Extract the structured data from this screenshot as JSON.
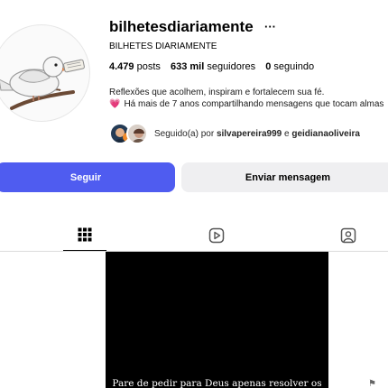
{
  "profile": {
    "username": "bilhetesdiariamente",
    "more_icon": "more-icon",
    "full_name": "BILHETES DIARIAMENTE",
    "stats": {
      "posts_count": "4.479",
      "posts_label": "posts",
      "followers_count": "633 mil",
      "followers_label": "seguidores",
      "following_count": "0",
      "following_label": "seguindo"
    },
    "bio": {
      "line1": "Reflexões que acolhem, inspiram e fortalecem sua fé.",
      "line2_emoji": "💗",
      "line2": "Há mais de 7 anos compartilhando mensagens que tocam almas"
    },
    "followed_by": {
      "prefix": "Seguido(a) por",
      "user1": "silvapereira999",
      "conjunction": "e",
      "user2": "geidianaoliveira"
    }
  },
  "actions": {
    "follow_label": "Seguir",
    "message_label": "Enviar mensagem"
  },
  "tabs": [
    {
      "icon": "grid-icon",
      "active": true
    },
    {
      "icon": "reels-icon",
      "active": false
    },
    {
      "icon": "tagged-icon",
      "active": false
    }
  ],
  "posts": [
    {
      "caption": "Pare de pedir para Deus apenas resolver os"
    }
  ],
  "colors": {
    "follow_button": "#4f5cf0",
    "message_button": "#efeff1",
    "heart": "#e0457b"
  }
}
